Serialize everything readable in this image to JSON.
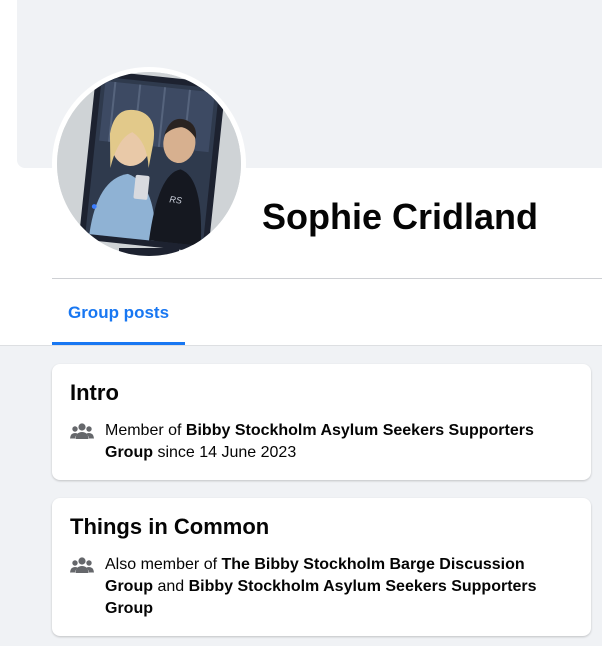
{
  "profile": {
    "name": "Sophie Cridland"
  },
  "tabs": [
    {
      "label": "Group posts",
      "active": true
    }
  ],
  "intro": {
    "title": "Intro",
    "member_prefix": "Member of ",
    "group_name": "Bibby Stockholm Asylum Seekers Supporters Group",
    "since_text": " since 14 June 2023",
    "icon": "people-icon"
  },
  "common": {
    "title": "Things in Common",
    "prefix": "Also member of ",
    "group_1": "The Bibby Stockholm Barge Discussion Group",
    "conjunction": " and ",
    "group_2": "Bibby Stockholm Asylum Seekers Supporters Group",
    "icon": "people-icon"
  },
  "colors": {
    "accent": "#1877f2",
    "page_bg": "#f0f2f5",
    "icon": "#65676b"
  }
}
